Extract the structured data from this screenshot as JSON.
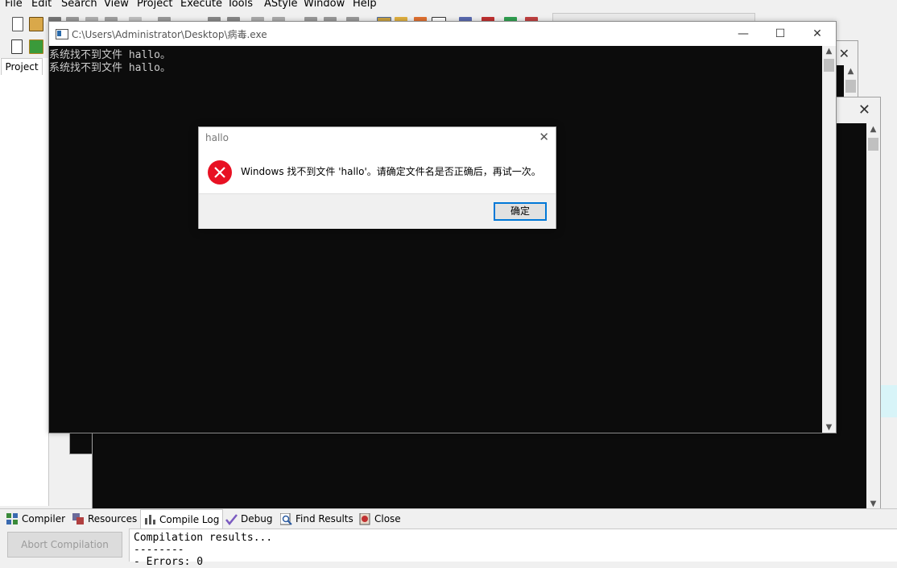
{
  "ide": {
    "menu": [
      "File",
      "Edit",
      "Search",
      "View",
      "Project",
      "Execute",
      "Tools",
      "AStyle",
      "Window",
      "Help"
    ],
    "project_tab": "Project",
    "bottom_tabs": [
      {
        "label": "Compiler",
        "icon": "grid-icon"
      },
      {
        "label": "Resources",
        "icon": "resources-icon"
      },
      {
        "label": "Compile Log",
        "icon": "chart-icon"
      },
      {
        "label": "Debug",
        "icon": "check-icon"
      },
      {
        "label": "Find Results",
        "icon": "find-icon"
      },
      {
        "label": "Close",
        "icon": "close-doc-icon"
      }
    ],
    "abort_button": "Abort Compilation",
    "log_lines": [
      "Compilation results...",
      "--------",
      "- Errors: 0"
    ]
  },
  "console": {
    "title": "C:\\Users\\Administrator\\Desktop\\病毒.exe",
    "lines": [
      "系统找不到文件 hallo。",
      "系统找不到文件 hallo。"
    ],
    "minimize": "—",
    "maximize": "☐",
    "close": "✕"
  },
  "back_windows": {
    "close": "✕"
  },
  "msgbox": {
    "title": "hallo",
    "message": "Windows 找不到文件 'hallo'。请确定文件名是否正确后，再试一次。",
    "ok_label": "确定",
    "close": "✕"
  },
  "colors": {
    "console_bg": "#0c0c0c",
    "console_text": "#cccccc",
    "error_red": "#e81123",
    "focus_blue": "#0078d7"
  }
}
